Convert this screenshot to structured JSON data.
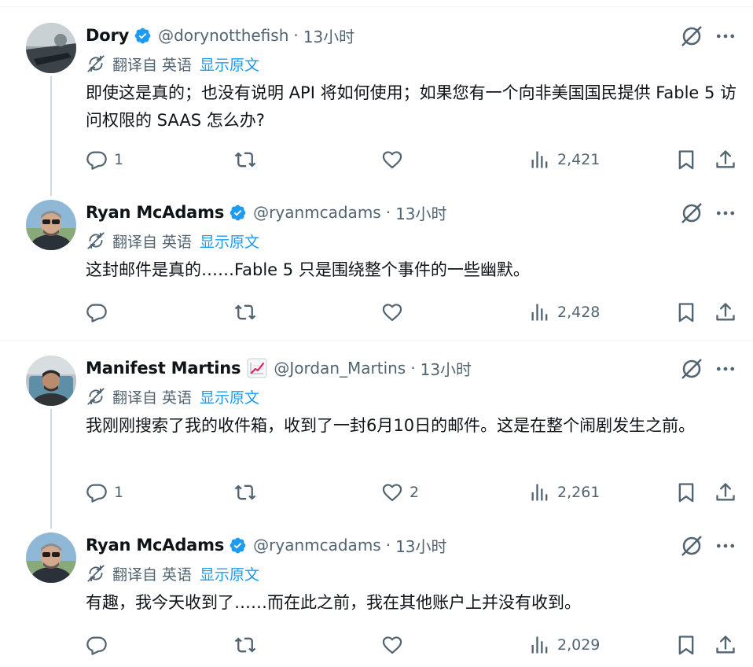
{
  "translate": {
    "label": "翻译自 英语",
    "show_original": "显示原文"
  },
  "colors": {
    "text": "#0f1419",
    "secondary": "#536471",
    "link": "#1d9bf0",
    "verified": "#1d9bf0",
    "thread_line": "#cfd9de",
    "divider": "#eff3f4"
  },
  "tweets": [
    {
      "name": "Dory",
      "verified": true,
      "handle": "@dorynotthefish",
      "dot": "·",
      "time": "13小时",
      "text": "即使这是真的；也没有说明 API 将如何使用；如果您有一个向非美国国民提供 Fable 5 访问权限的 SAAS 怎么办?",
      "replies": "1",
      "reposts": "",
      "likes": "",
      "views": "2,421"
    },
    {
      "name": "Ryan McAdams",
      "verified": true,
      "handle": "@ryanmcadams",
      "dot": "·",
      "time": "13小时",
      "text": "这封邮件是真的……Fable 5 只是围绕整个事件的一些幽默。",
      "replies": "",
      "reposts": "",
      "likes": "",
      "views": "2,428"
    },
    {
      "name": "Manifest Martins",
      "verified": false,
      "badge_icon": "chart-increasing-emoji",
      "handle": "@Jordan_Martins",
      "dot": "·",
      "time": "13小时",
      "text": "我刚刚搜索了我的收件箱，收到了一封6月10日的邮件。这是在整个闹剧发生之前。",
      "replies": "1",
      "reposts": "",
      "likes": "2",
      "views": "2,261"
    },
    {
      "name": "Ryan McAdams",
      "verified": true,
      "handle": "@ryanmcadams",
      "dot": "·",
      "time": "13小时",
      "text": "有趣，我今天收到了……而在此之前，我在其他账户上并没有收到。",
      "replies": "",
      "reposts": "",
      "likes": "",
      "views": "2,029"
    }
  ]
}
